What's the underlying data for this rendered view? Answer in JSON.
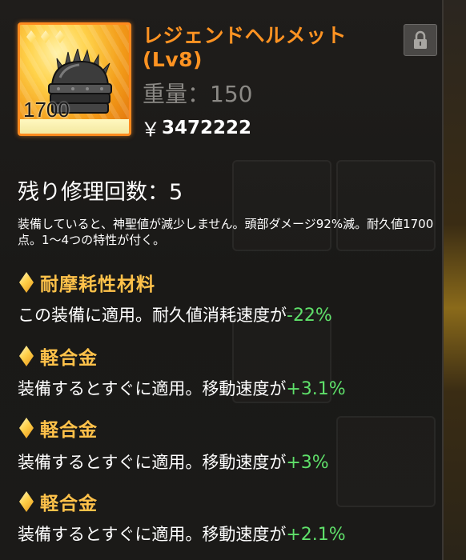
{
  "item": {
    "title": "レジェンドヘルメット(Lv8)",
    "weight": "重量：150",
    "price_symbol": "￥",
    "price": "3472222",
    "durability": "1700",
    "rarity_stars": 3,
    "icon": "spiked-helmet-icon",
    "lock_icon": "lock-icon"
  },
  "repair": "残り修理回数：5",
  "description": "装備していると、神聖値が減少しません。頭部ダメージ92%減。耐久値1700点。1～4つの特性が付く。",
  "attributes": [
    {
      "name": "耐摩耗性材料",
      "text": "この装備に適用。耐久値消耗速度が",
      "value": "-22%"
    },
    {
      "name": "軽合金",
      "text": "装備するとすぐに適用。移動速度が",
      "value": "+3.1%"
    },
    {
      "name": "軽合金",
      "text": "装備するとすぐに適用。移動速度が",
      "value": "+3%"
    },
    {
      "name": "軽合金",
      "text": "装備するとすぐに適用。移動速度が",
      "value": "+2.1%"
    }
  ],
  "colors": {
    "title": "#ff9322",
    "attr_title": "#ffc24a",
    "value": "#5fe06a",
    "weight": "#8b8985"
  }
}
